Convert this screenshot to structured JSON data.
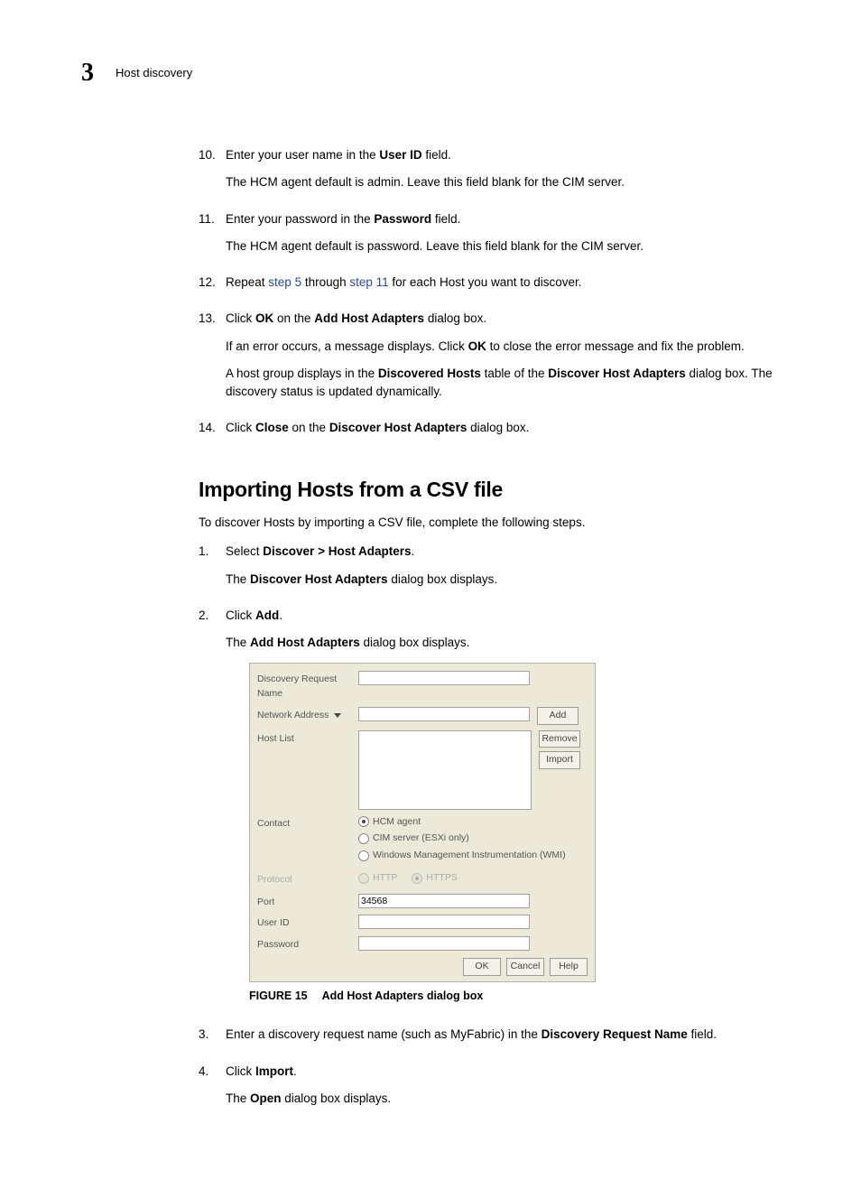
{
  "header": {
    "chapter_number": "3",
    "title": "Host discovery"
  },
  "steps_top": [
    {
      "num": "10.",
      "line1_before": "Enter your user name in the ",
      "line1_bold": "User ID",
      "line1_after": " field.",
      "para2": "The HCM agent default is admin. Leave this field blank for the CIM server."
    },
    {
      "num": "11.",
      "line1_before": "Enter your password in the ",
      "line1_bold": "Password",
      "line1_after": " field.",
      "para2": "The HCM agent default is password. Leave this field blank for the CIM server."
    },
    {
      "num": "12.",
      "repeat_before": "Repeat ",
      "repeat_link1": "step 5",
      "repeat_mid": " through ",
      "repeat_link2": "step 11",
      "repeat_after": " for each Host you want to discover."
    },
    {
      "num": "13.",
      "click_before": "Click ",
      "click_bold1": "OK",
      "click_mid": " on the ",
      "click_bold2": "Add Host Adapters",
      "click_after": " dialog box.",
      "err_before": "If an error occurs, a message displays. Click ",
      "err_bold": "OK",
      "err_after": " to close the error message and fix the problem.",
      "grp_before": "A host group displays in the ",
      "grp_bold1": "Discovered Hosts",
      "grp_mid": " table of the ",
      "grp_bold2": "Discover Host Adapters",
      "grp_after": " dialog box. The discovery status is updated dynamically."
    },
    {
      "num": "14.",
      "click_before": "Click ",
      "click_bold1": "Close",
      "click_mid": " on the ",
      "click_bold2": "Discover Host Adapters",
      "click_after": " dialog box."
    }
  ],
  "section": {
    "title": "Importing Hosts from a CSV file",
    "intro": "To discover Hosts by importing a CSV file, complete the following steps."
  },
  "steps_bottom": [
    {
      "num": "1.",
      "before": "Select ",
      "bold": "Discover > Host Adapters",
      "after": ".",
      "p2_before": "The ",
      "p2_bold": "Discover Host Adapters",
      "p2_after": " dialog box displays."
    },
    {
      "num": "2.",
      "before": "Click ",
      "bold": "Add",
      "after": ".",
      "p2_before": "The ",
      "p2_bold": "Add Host Adapters",
      "p2_after": " dialog box displays."
    },
    {
      "num": "3.",
      "before": "Enter a discovery request name (such as MyFabric) in the ",
      "bold": "Discovery Request Name",
      "after": " field."
    },
    {
      "num": "4.",
      "before": "Click ",
      "bold": "Import",
      "after": ".",
      "p2_before": "The ",
      "p2_bold": "Open",
      "p2_after": " dialog box displays."
    }
  ],
  "dialog": {
    "labels": {
      "discovery_request_name": "Discovery Request Name",
      "network_address": "Network Address",
      "host_list": "Host List",
      "contact": "Contact",
      "protocol": "Protocol",
      "port": "Port",
      "user_id": "User ID",
      "password": "Password"
    },
    "buttons": {
      "add": "Add",
      "remove": "Remove",
      "import": "Import",
      "ok": "OK",
      "cancel": "Cancel",
      "help": "Help"
    },
    "contact_options": {
      "hcm": "HCM agent",
      "cim": "CIM server (ESXi only)",
      "wmi": "Windows Management Instrumentation (WMI)"
    },
    "protocol_options": {
      "http": "HTTP",
      "https": "HTTPS"
    },
    "port_value": "34568"
  },
  "figure": {
    "label": "FIGURE 15",
    "caption": "Add Host Adapters dialog box"
  }
}
